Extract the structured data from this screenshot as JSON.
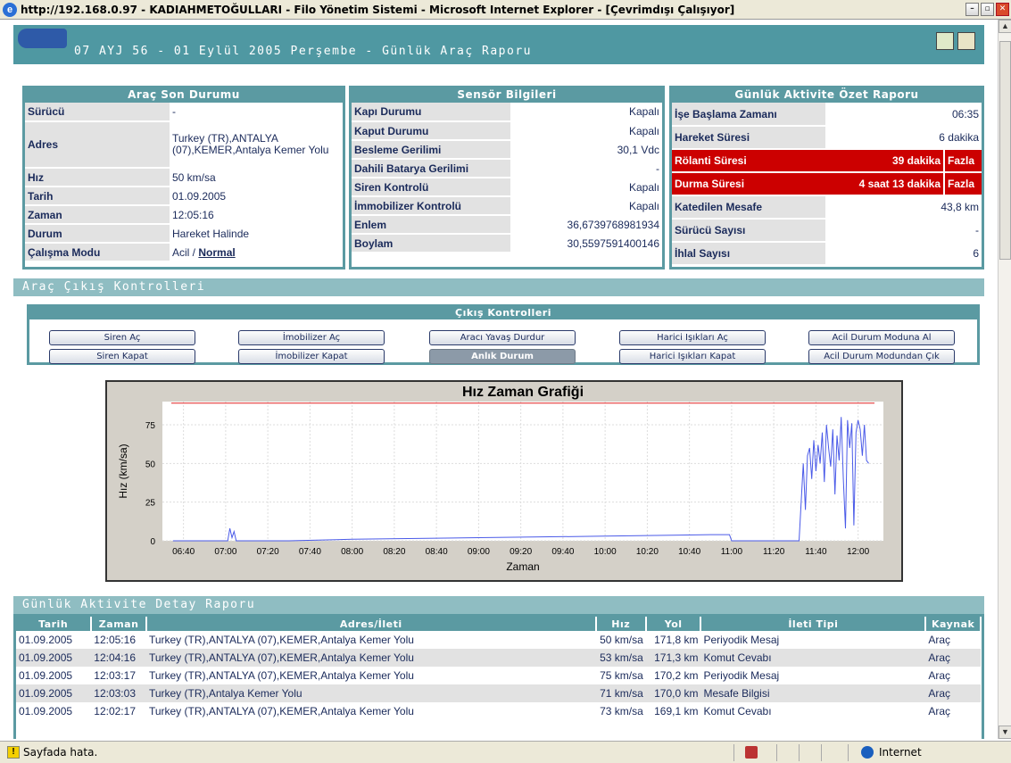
{
  "window": {
    "title": "http://192.168.0.97 - KADIAHMETOĞULLARI - Filo Yönetim Sistemi - Microsoft Internet Explorer - [Çevrimdışı Çalışıyor]",
    "btn_min": "–",
    "btn_max": "▫",
    "btn_close": "✕"
  },
  "header": {
    "title": "07 AYJ 56 - 01 Eylül 2005 Perşembe - Günlük Araç Raporu"
  },
  "arac": {
    "title": "Araç Son Durumu",
    "rows": [
      {
        "k": "Sürücü",
        "v": "-"
      },
      {
        "k": "Adres",
        "v": "Turkey (TR),ANTALYA (07),KEMER,Antalya Kemer Yolu"
      },
      {
        "k": "Hız",
        "v": "50 km/sa"
      },
      {
        "k": "Tarih",
        "v": "01.09.2005"
      },
      {
        "k": "Zaman",
        "v": "12:05:16"
      },
      {
        "k": "Durum",
        "v": "Hareket Halinde"
      }
    ],
    "mode_label": "Çalışma Modu",
    "mode_a": "Acil",
    "mode_sep": " / ",
    "mode_b": "Normal"
  },
  "sensor": {
    "title": "Sensör Bilgileri",
    "rows": [
      {
        "k": "Kapı Durumu",
        "v": "Kapalı"
      },
      {
        "k": "Kaput Durumu",
        "v": "Kapalı"
      },
      {
        "k": "Besleme Gerilimi",
        "v": "30,1 Vdc"
      },
      {
        "k": "Dahili Batarya Gerilimi",
        "v": "-"
      },
      {
        "k": "Siren Kontrolü",
        "v": "Kapalı"
      },
      {
        "k": "İmmobilizer Kontrolü",
        "v": "Kapalı"
      },
      {
        "k": "Enlem",
        "v": "36,6739768981934"
      },
      {
        "k": "Boylam",
        "v": "30,5597591400146"
      }
    ]
  },
  "ozet": {
    "title": "Günlük Aktivite Özet Raporu",
    "rows": [
      {
        "k": "İşe Başlama Zamanı",
        "v": "06:35"
      },
      {
        "k": "Hareket Süresi",
        "v": "6 dakika"
      },
      {
        "k": "Rölanti Süresi",
        "v": "39 dakika",
        "flag": "Fazla"
      },
      {
        "k": "Durma Süresi",
        "v": "4 saat  13 dakika",
        "flag": "Fazla"
      },
      {
        "k": "Katedilen Mesafe",
        "v": "43,8 km"
      },
      {
        "k": "Sürücü Sayısı",
        "v": "-"
      },
      {
        "k": "İhlal Sayısı",
        "v": "6"
      }
    ],
    "alert_color": "#cc0000"
  },
  "cikis_section": "Araç Çıkış Kontrolleri",
  "cikis": {
    "title": "Çıkış Kontrolleri",
    "buttons": [
      "Siren Aç",
      "İmobilizer Aç",
      "Aracı Yavaş Durdur",
      "Harici Işıkları Aç",
      "Acil Durum Moduna Al",
      "Siren Kapat",
      "İmobilizer Kapat",
      "Anlık Durum",
      "Harici Işıkları Kapat",
      "Acil Durum Modundan Çık"
    ]
  },
  "chart_data": {
    "type": "line",
    "title": "Hız Zaman Grafiği",
    "xlabel": "Zaman",
    "ylabel": "Hız (km/sa)",
    "ylim": [
      0,
      90
    ],
    "yticks": [
      0,
      25,
      50,
      75
    ],
    "xticks": [
      "06:40",
      "07:00",
      "07:20",
      "07:40",
      "08:00",
      "08:20",
      "08:40",
      "09:00",
      "09:20",
      "09:40",
      "10:00",
      "10:20",
      "10:40",
      "11:00",
      "11:20",
      "11:40",
      "12:00"
    ],
    "limit_line": 89,
    "grid": true,
    "series": [
      {
        "values": [
          [
            "06:35",
            0
          ],
          [
            "07:01",
            0
          ],
          [
            "07:02",
            8
          ],
          [
            "07:03",
            2
          ],
          [
            "07:04",
            6
          ],
          [
            "07:05",
            0
          ],
          [
            "07:30",
            0
          ],
          [
            "08:00",
            1
          ],
          [
            "09:00",
            2
          ],
          [
            "10:00",
            3
          ],
          [
            "10:50",
            4
          ],
          [
            "10:59",
            4
          ],
          [
            "11:00",
            0
          ],
          [
            "11:32",
            0
          ],
          [
            "11:34",
            50
          ],
          [
            "11:35",
            20
          ],
          [
            "11:36",
            55
          ],
          [
            "11:37",
            60
          ],
          [
            "11:38",
            40
          ],
          [
            "11:39",
            65
          ],
          [
            "11:40",
            45
          ],
          [
            "11:41",
            62
          ],
          [
            "11:42",
            50
          ],
          [
            "11:43",
            70
          ],
          [
            "11:44",
            38
          ],
          [
            "11:45",
            75
          ],
          [
            "11:46",
            60
          ],
          [
            "11:47",
            48
          ],
          [
            "11:48",
            72
          ],
          [
            "11:49",
            30
          ],
          [
            "11:50",
            68
          ],
          [
            "11:51",
            52
          ],
          [
            "11:52",
            80
          ],
          [
            "11:53",
            40
          ],
          [
            "11:54",
            8
          ],
          [
            "11:55",
            78
          ],
          [
            "11:56",
            60
          ],
          [
            "11:57",
            76
          ],
          [
            "11:58",
            10
          ],
          [
            "11:59",
            70
          ],
          [
            "12:00",
            78
          ],
          [
            "12:01",
            72
          ],
          [
            "12:02",
            55
          ],
          [
            "12:03",
            75
          ],
          [
            "12:04",
            52
          ],
          [
            "12:05",
            50
          ]
        ],
        "color": "#4a5ae8"
      }
    ],
    "limit_color": "#e02020"
  },
  "detay_section": "Günlük Aktivite Detay Raporu",
  "detay": {
    "columns": [
      "Tarih",
      "Zaman",
      "Adres/İleti",
      "Hız",
      "Yol",
      "İleti Tipi",
      "Kaynak"
    ],
    "rows": [
      [
        "01.09.2005",
        "12:05:16",
        "Turkey (TR),ANTALYA (07),KEMER,Antalya Kemer Yolu",
        "50 km/sa",
        "171,8 km",
        "Periyodik Mesaj",
        "Araç"
      ],
      [
        "01.09.2005",
        "12:04:16",
        "Turkey (TR),ANTALYA (07),KEMER,Antalya Kemer Yolu",
        "53 km/sa",
        "171,3 km",
        "Komut Cevabı",
        "Araç"
      ],
      [
        "01.09.2005",
        "12:03:17",
        "Turkey (TR),ANTALYA (07),KEMER,Antalya Kemer Yolu",
        "75 km/sa",
        "170,2 km",
        "Periyodik Mesaj",
        "Araç"
      ],
      [
        "01.09.2005",
        "12:03:03",
        "Turkey (TR),Antalya Kemer Yolu",
        "71 km/sa",
        "170,0 km",
        "Mesafe Bilgisi",
        "Araç"
      ],
      [
        "01.09.2005",
        "12:02:17",
        "Turkey (TR),ANTALYA (07),KEMER,Antalya Kemer Yolu",
        "73 km/sa",
        "169,1 km",
        "Komut Cevabı",
        "Araç"
      ]
    ]
  },
  "statusbar": {
    "text": "Sayfada hata.",
    "zone": "Internet"
  }
}
